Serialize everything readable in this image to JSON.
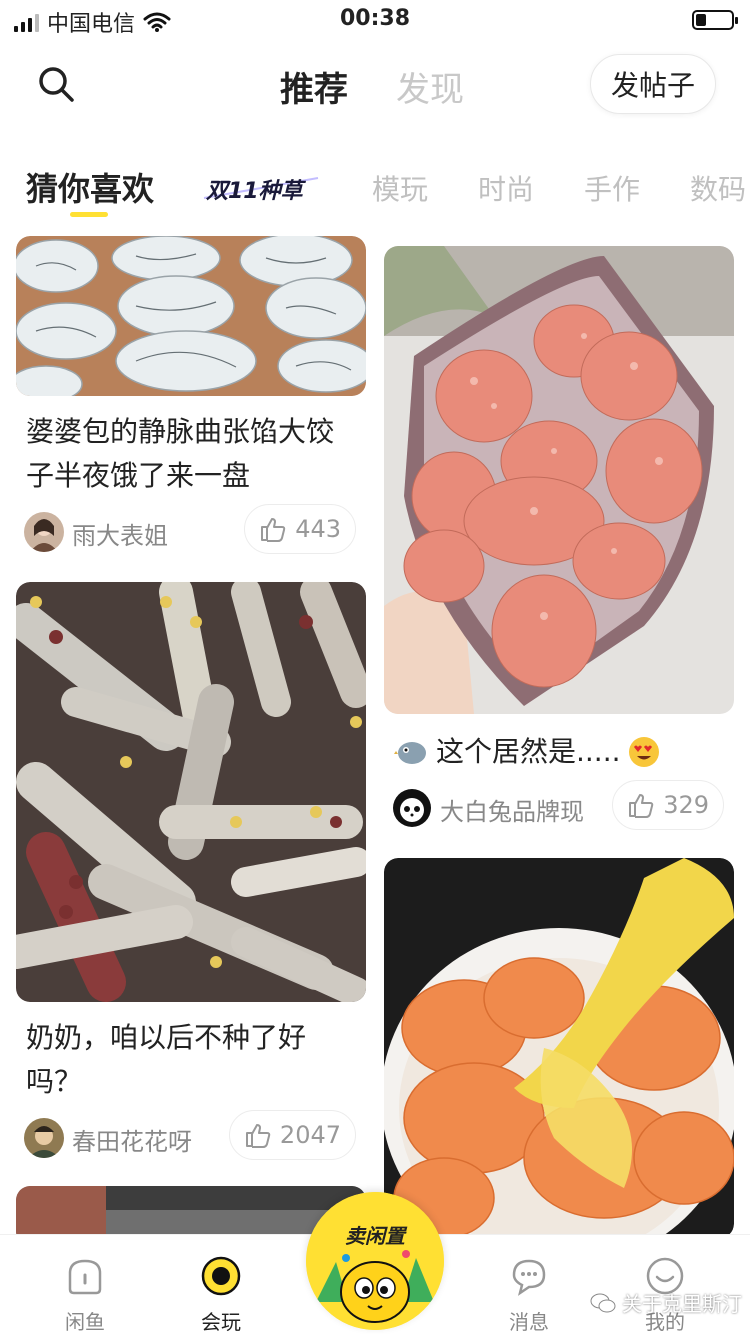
{
  "status_bar": {
    "carrier": "中国电信",
    "time": "00:38",
    "battery_level": 0.3
  },
  "header": {
    "tabs": [
      {
        "label": "推荐",
        "active": true
      },
      {
        "label": "发现",
        "active": false
      }
    ],
    "post_button_label": "发帖子"
  },
  "category_tabs": {
    "items": [
      "猜你喜欢",
      "双11种草",
      "模玩",
      "时尚",
      "手作",
      "数码"
    ],
    "active": "猜你喜欢"
  },
  "feed": {
    "left": [
      {
        "title": "婆婆包的静脉曲张馅大饺子半夜饿了来一盘",
        "author": "雨大表姐",
        "likes": "443"
      },
      {
        "title": "奶奶，咱以后不种了好吗？",
        "author": "春田花花呀",
        "likes": "2047"
      }
    ],
    "right": [
      {
        "title": "这个居然是.....",
        "author": "大白兔品牌现",
        "likes": "329"
      }
    ]
  },
  "tabbar": {
    "items": [
      {
        "label": "闲鱼",
        "icon": "xianyu-home-icon",
        "active": false
      },
      {
        "label": "会玩",
        "icon": "play-ring-icon",
        "active": true
      },
      {
        "label": "卖闲置",
        "icon": "sell-mascot-icon",
        "active": false
      },
      {
        "label": "消息",
        "icon": "message-bubble-icon",
        "active": false
      },
      {
        "label": "我的",
        "icon": "profile-smile-icon",
        "active": false
      }
    ]
  },
  "watermark": "关于克里斯汀",
  "colors": {
    "accent": "#ffe033",
    "text": "#222222",
    "muted": "#c0c0c0"
  }
}
